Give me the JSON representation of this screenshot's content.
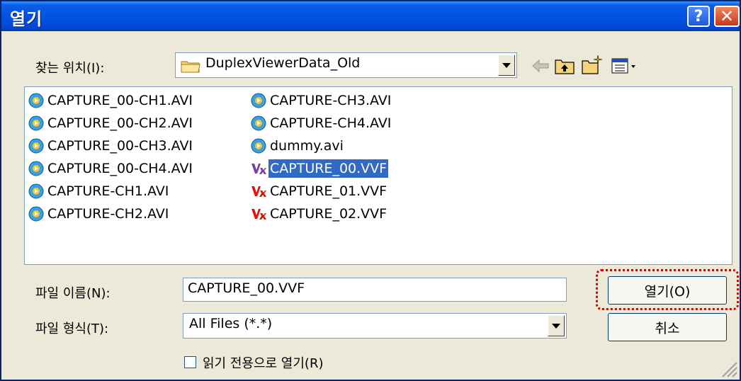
{
  "window": {
    "title": "열기"
  },
  "titlebar": {
    "help_glyph": "?",
    "close_glyph": "✕"
  },
  "lookin": {
    "label": "찾는 위치(I):",
    "value": "DuplexViewerData_Old"
  },
  "toolbar": {
    "back_glyph": "🡐"
  },
  "files": [
    {
      "name": "CAPTURE_00-CH1.AVI",
      "type": "avi",
      "selected": false
    },
    {
      "name": "CAPTURE_00-CH2.AVI",
      "type": "avi",
      "selected": false
    },
    {
      "name": "CAPTURE_00-CH3.AVI",
      "type": "avi",
      "selected": false
    },
    {
      "name": "CAPTURE_00-CH4.AVI",
      "type": "avi",
      "selected": false
    },
    {
      "name": "CAPTURE-CH1.AVI",
      "type": "avi",
      "selected": false
    },
    {
      "name": "CAPTURE-CH2.AVI",
      "type": "avi",
      "selected": false
    },
    {
      "name": "CAPTURE-CH3.AVI",
      "type": "avi",
      "selected": false
    },
    {
      "name": "CAPTURE-CH4.AVI",
      "type": "avi",
      "selected": false
    },
    {
      "name": "dummy.avi",
      "type": "avi",
      "selected": false
    },
    {
      "name": "CAPTURE_00.VVF",
      "type": "vvf",
      "selected": true
    },
    {
      "name": "CAPTURE_01.VVF",
      "type": "vvf",
      "selected": false
    },
    {
      "name": "CAPTURE_02.VVF",
      "type": "vvf",
      "selected": false
    }
  ],
  "filename": {
    "label": "파일 이름(N):",
    "value": "CAPTURE_00.VVF"
  },
  "filetype": {
    "label": "파일 형식(T):",
    "value": "All Files (*.*)"
  },
  "buttons": {
    "open": "열기(O)",
    "cancel": "취소"
  },
  "readonly": {
    "label": "읽기 전용으로 열기(R)",
    "checked": false
  },
  "colors": {
    "titlebar": "#0054e3",
    "selection": "#316ac5",
    "focus_ring": "#d90000",
    "dialog_bg": "#ece9d8"
  }
}
